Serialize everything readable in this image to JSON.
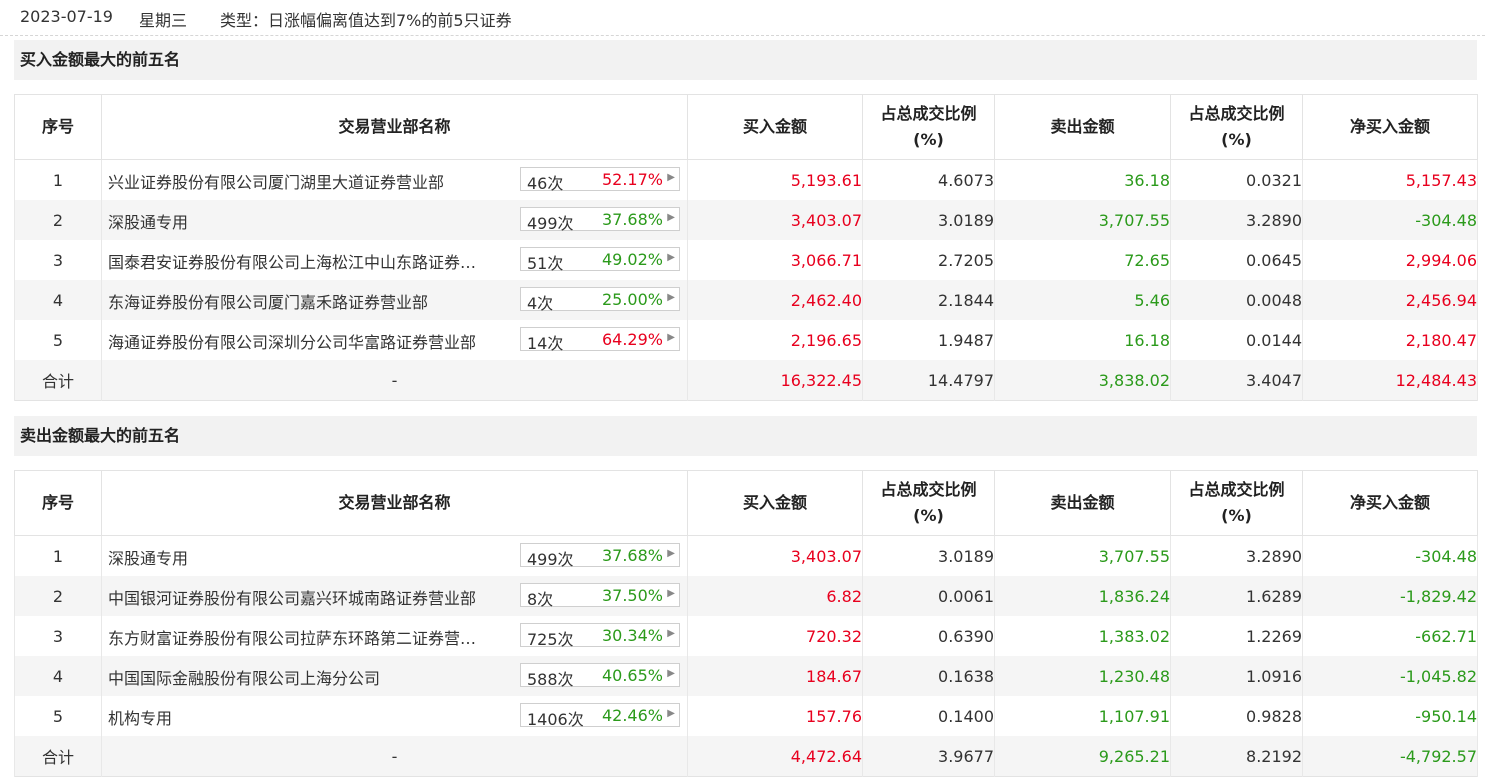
{
  "info_bar": {
    "date": "2023-07-19",
    "weekday": "星期三",
    "type_label": "类型：日涨幅偏离值达到7%的前5只证券"
  },
  "headers": {
    "idx": "序号",
    "name": "交易营业部名称",
    "buy": "买入金额",
    "buy_ratio_l1": "占总成交比例",
    "buy_ratio_l2": "(%)",
    "sell": "卖出金额",
    "sell_ratio_l1": "占总成交比例",
    "sell_ratio_l2": "(%)",
    "net": "净买入金额"
  },
  "colors": {
    "red": "#e8001e",
    "green": "#2b9a1b"
  },
  "buy_section": {
    "title": "买入金额最大的前五名",
    "rows": [
      {
        "idx": "1",
        "name": "兴业证券股份有限公司厦门湖里大道证券营业部",
        "count": "46次",
        "pct": "52.17%",
        "pct_color": "red",
        "buy": "5,193.61",
        "buy_ratio": "4.6073",
        "sell": "36.18",
        "sell_ratio": "0.0321",
        "net": "5,157.43",
        "net_color": "red"
      },
      {
        "idx": "2",
        "name": "深股通专用",
        "count": "499次",
        "pct": "37.68%",
        "pct_color": "green",
        "buy": "3,403.07",
        "buy_ratio": "3.0189",
        "sell": "3,707.55",
        "sell_ratio": "3.2890",
        "net": "-304.48",
        "net_color": "green"
      },
      {
        "idx": "3",
        "name": "国泰君安证券股份有限公司上海松江中山东路证券…",
        "count": "51次",
        "pct": "49.02%",
        "pct_color": "green",
        "buy": "3,066.71",
        "buy_ratio": "2.7205",
        "sell": "72.65",
        "sell_ratio": "0.0645",
        "net": "2,994.06",
        "net_color": "red"
      },
      {
        "idx": "4",
        "name": "东海证券股份有限公司厦门嘉禾路证券营业部",
        "count": "4次",
        "pct": "25.00%",
        "pct_color": "green",
        "buy": "2,462.40",
        "buy_ratio": "2.1844",
        "sell": "5.46",
        "sell_ratio": "0.0048",
        "net": "2,456.94",
        "net_color": "red"
      },
      {
        "idx": "5",
        "name": "海通证券股份有限公司深圳分公司华富路证券营业部",
        "count": "14次",
        "pct": "64.29%",
        "pct_color": "red",
        "buy": "2,196.65",
        "buy_ratio": "1.9487",
        "sell": "16.18",
        "sell_ratio": "0.0144",
        "net": "2,180.47",
        "net_color": "red"
      }
    ],
    "total": {
      "label": "合计",
      "name": "-",
      "buy": "16,322.45",
      "buy_ratio": "14.4797",
      "sell": "3,838.02",
      "sell_ratio": "3.4047",
      "net": "12,484.43",
      "net_color": "red"
    }
  },
  "sell_section": {
    "title": "卖出金额最大的前五名",
    "rows": [
      {
        "idx": "1",
        "name": "深股通专用",
        "count": "499次",
        "pct": "37.68%",
        "pct_color": "green",
        "buy": "3,403.07",
        "buy_ratio": "3.0189",
        "sell": "3,707.55",
        "sell_ratio": "3.2890",
        "net": "-304.48",
        "net_color": "green"
      },
      {
        "idx": "2",
        "name": "中国银河证券股份有限公司嘉兴环城南路证券营业部",
        "count": "8次",
        "pct": "37.50%",
        "pct_color": "green",
        "buy": "6.82",
        "buy_ratio": "0.0061",
        "sell": "1,836.24",
        "sell_ratio": "1.6289",
        "net": "-1,829.42",
        "net_color": "green"
      },
      {
        "idx": "3",
        "name": "东方财富证券股份有限公司拉萨东环路第二证券营…",
        "count": "725次",
        "pct": "30.34%",
        "pct_color": "green",
        "buy": "720.32",
        "buy_ratio": "0.6390",
        "sell": "1,383.02",
        "sell_ratio": "1.2269",
        "net": "-662.71",
        "net_color": "green"
      },
      {
        "idx": "4",
        "name": "中国国际金融股份有限公司上海分公司",
        "count": "588次",
        "pct": "40.65%",
        "pct_color": "green",
        "buy": "184.67",
        "buy_ratio": "0.1638",
        "sell": "1,230.48",
        "sell_ratio": "1.0916",
        "net": "-1,045.82",
        "net_color": "green"
      },
      {
        "idx": "5",
        "name": "机构专用",
        "count": "1406次",
        "pct": "42.46%",
        "pct_color": "green",
        "buy": "157.76",
        "buy_ratio": "0.1400",
        "sell": "1,107.91",
        "sell_ratio": "0.9828",
        "net": "-950.14",
        "net_color": "green"
      }
    ],
    "total": {
      "label": "合计",
      "name": "-",
      "buy": "4,472.64",
      "buy_ratio": "3.9677",
      "sell": "9,265.21",
      "sell_ratio": "8.2192",
      "net": "-4,792.57",
      "net_color": "green"
    }
  }
}
